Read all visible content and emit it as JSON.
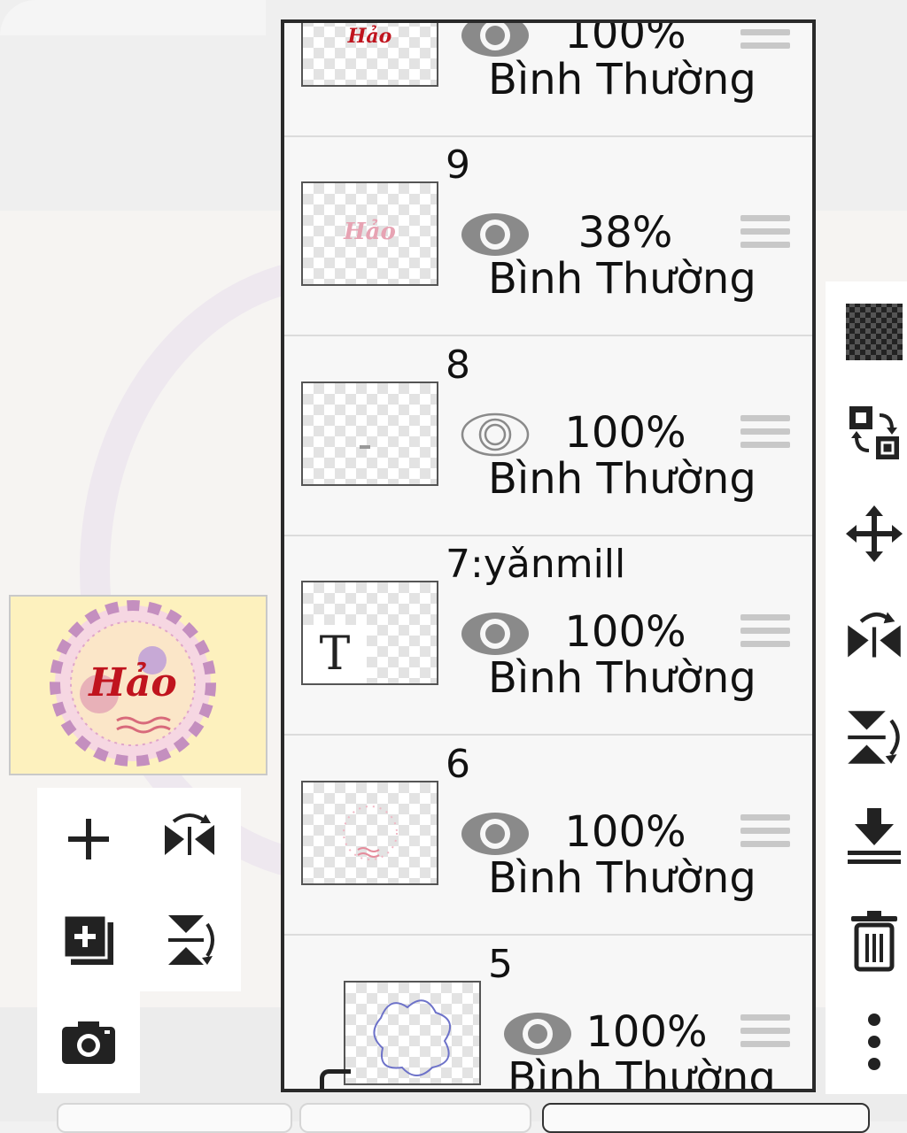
{
  "layers": [
    {
      "name": "",
      "opacity": "100%",
      "blend": "Bình Thường",
      "visible": true,
      "thumb_text": "Hảo"
    },
    {
      "name": "9",
      "opacity": "38%",
      "blend": "Bình Thường",
      "visible": true,
      "thumb_text": "Hảo"
    },
    {
      "name": "8",
      "opacity": "100%",
      "blend": "Bình Thường",
      "visible": false
    },
    {
      "name": "7:yǎnmill",
      "opacity": "100%",
      "blend": "Bình Thường",
      "visible": true,
      "thumb_text": "T"
    },
    {
      "name": "6",
      "opacity": "100%",
      "blend": "Bình Thường",
      "visible": true
    },
    {
      "name": "5",
      "opacity": "100%",
      "blend": "Bình Thường",
      "visible": true
    }
  ],
  "navigator": {
    "artwork_text": "Hảo"
  },
  "left_tools": [
    {
      "icon": "plus-icon"
    },
    {
      "icon": "flip-horizontal-icon"
    },
    {
      "icon": "add-layer-icon"
    },
    {
      "icon": "flip-vertical-icon"
    },
    {
      "icon": "camera-icon"
    }
  ],
  "right_tools": [
    {
      "icon": "checkerboard-icon"
    },
    {
      "icon": "swap-layer-icon"
    },
    {
      "icon": "move-icon"
    },
    {
      "icon": "flip-horizontal-icon"
    },
    {
      "icon": "flip-vertical-icon"
    },
    {
      "icon": "merge-down-icon"
    },
    {
      "icon": "trash-icon"
    },
    {
      "icon": "more-icon"
    }
  ],
  "colors": {
    "panel_border": "#2a2a2a",
    "eye_gray": "#8a8a8a",
    "accent_red": "#c0141e",
    "navigator_bg": "#fdf1be"
  }
}
